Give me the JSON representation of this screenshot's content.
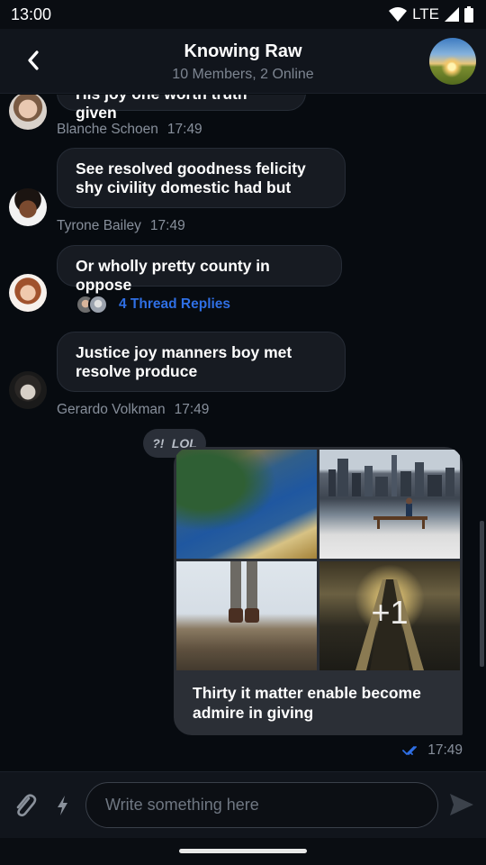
{
  "status_bar": {
    "time": "13:00",
    "network": "LTE"
  },
  "header": {
    "title": "Knowing Raw",
    "subtitle": "10 Members, 2 Online"
  },
  "messages": [
    {
      "text": "His joy one worth truth given",
      "sender": "Blanche Schoen",
      "time": "17:49"
    },
    {
      "text": "See resolved goodness felicity shy civility domestic had but",
      "sender": "Tyrone Bailey",
      "time": "17:49"
    },
    {
      "text": "Or wholly pretty county in oppose",
      "thread_replies": "4 Thread Replies"
    },
    {
      "text": "Justice joy manners boy met resolve produce",
      "sender": "Gerardo Volkman",
      "time": "17:49"
    }
  ],
  "own_message": {
    "reactions": [
      "?!",
      "LOL"
    ],
    "more_images": "+1",
    "text": "Thirty it matter enable become admire in giving",
    "time": "17:49",
    "status_icon": "double-check-icon"
  },
  "composer": {
    "placeholder": "Write something here",
    "value": ""
  },
  "colors": {
    "background": "#070b10",
    "bubble": "#171b22",
    "own_bubble": "#2b2f36",
    "accent": "#2f6fe4",
    "meta_text": "#878f9b"
  }
}
